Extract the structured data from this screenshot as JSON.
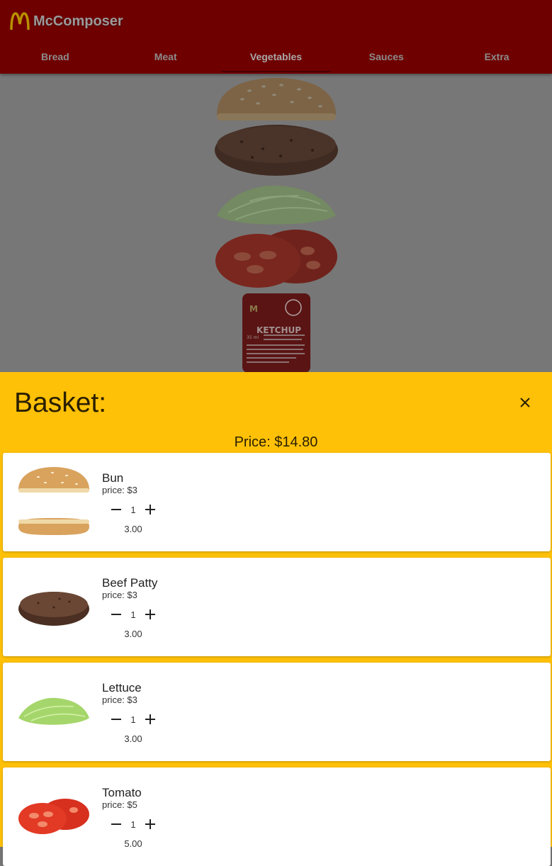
{
  "app": {
    "title": "McComposer"
  },
  "tabs": [
    {
      "label": "Bread"
    },
    {
      "label": "Meat"
    },
    {
      "label": "Vegetables"
    },
    {
      "label": "Sauces"
    },
    {
      "label": "Extra"
    }
  ],
  "active_tab": "Vegetables",
  "burger_layers": [
    "bun",
    "beef-patty",
    "lettuce",
    "tomato",
    "ketchup"
  ],
  "ketchup": {
    "brand": "M",
    "label": "KETCHUP",
    "volume": "35 ml"
  },
  "basket": {
    "title": "Basket:",
    "total": "Price: $14.80",
    "items": [
      {
        "name": "Bun",
        "price": "price: $3",
        "qty": "1",
        "subtotal": "3.00"
      },
      {
        "name": "Beef Patty",
        "price": "price: $3",
        "qty": "1",
        "subtotal": "3.00"
      },
      {
        "name": "Lettuce",
        "price": "price: $3",
        "qty": "1",
        "subtotal": "3.00"
      },
      {
        "name": "Tomato",
        "price": "price: $5",
        "qty": "1",
        "subtotal": "5.00"
      }
    ]
  },
  "colors": {
    "header": "#6f0000",
    "overlay": "#777777",
    "sheet": "#ffc107",
    "card": "#ffffff"
  },
  "icons": [
    "mcdonalds-logo-icon",
    "close-icon",
    "minus-icon",
    "plus-icon"
  ]
}
